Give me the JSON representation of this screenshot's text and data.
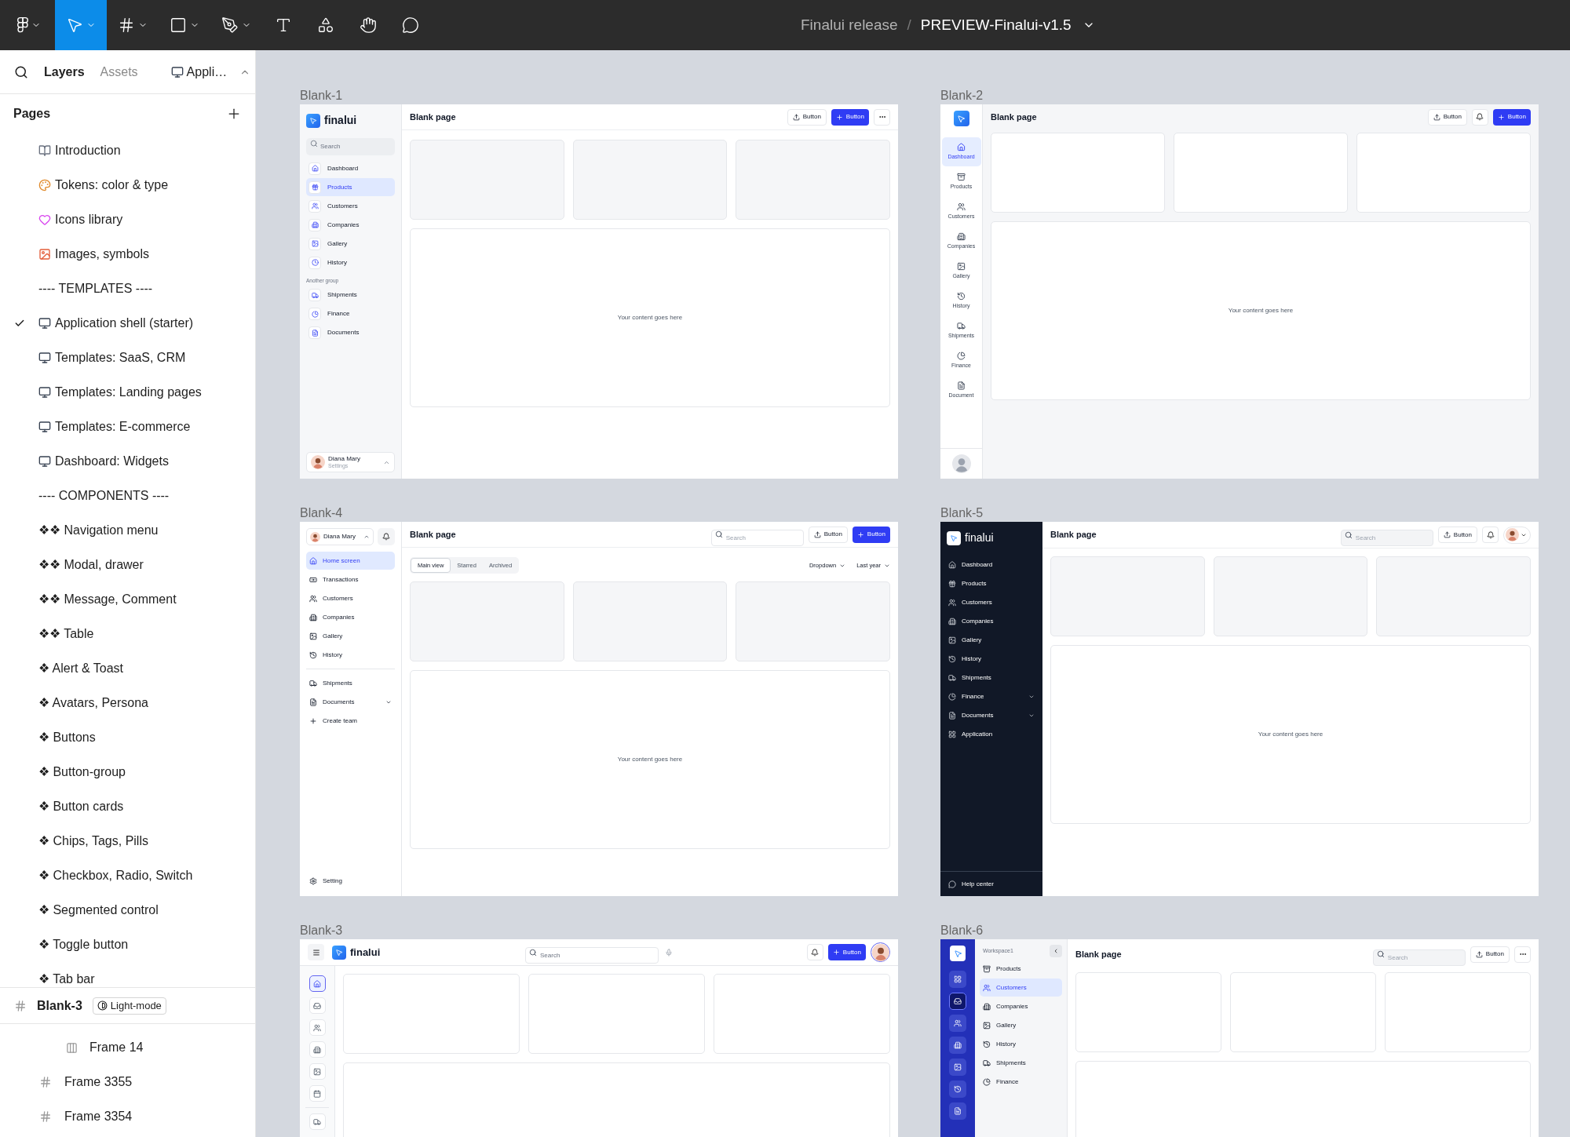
{
  "toolbar": {
    "tools": [
      {
        "selected": false,
        "menu": true
      },
      {
        "selected": true,
        "menu": true
      },
      {
        "selected": false,
        "menu": true
      },
      {
        "selected": false,
        "menu": true
      },
      {
        "selected": false,
        "menu": true
      },
      {
        "selected": false,
        "menu": false
      },
      {
        "selected": false,
        "menu": false
      },
      {
        "selected": false,
        "menu": false
      },
      {
        "selected": false,
        "menu": false
      }
    ],
    "project": "Finalui release",
    "separator": "/",
    "file": "PREVIEW-Finalui-v1.5"
  },
  "left_panel": {
    "tabs": [
      {
        "label": "Layers",
        "selected": true
      },
      {
        "label": "Assets",
        "selected": false
      }
    ],
    "page_picker": "Appli…",
    "pages_title": "Pages",
    "pages": [
      {
        "label": "Introduction",
        "kind": "book",
        "selected": false
      },
      {
        "label": "Tokens: color & type",
        "kind": "palette",
        "selected": false
      },
      {
        "label": "Icons library",
        "kind": "heart",
        "selected": false
      },
      {
        "label": "Images, symbols",
        "kind": "image",
        "selected": false
      },
      {
        "label": "---- TEMPLATES ----",
        "kind": "text",
        "selected": false
      },
      {
        "label": "Application shell (starter)",
        "kind": "monitor",
        "selected": true
      },
      {
        "label": "Templates: SaaS, CRM",
        "kind": "monitor",
        "selected": false
      },
      {
        "label": "Templates: Landing pages",
        "kind": "monitor",
        "selected": false
      },
      {
        "label": "Templates: E-commerce",
        "kind": "monitor",
        "selected": false
      },
      {
        "label": "Dashboard: Widgets",
        "kind": "monitor",
        "selected": false
      },
      {
        "label": "---- COMPONENTS ----",
        "kind": "text",
        "selected": false
      },
      {
        "label": "❖❖ Navigation menu",
        "kind": "text",
        "selected": false
      },
      {
        "label": "❖❖ Modal, drawer",
        "kind": "text",
        "selected": false
      },
      {
        "label": "❖❖ Message, Comment",
        "kind": "text",
        "selected": false
      },
      {
        "label": "❖❖ Table",
        "kind": "text",
        "selected": false
      },
      {
        "label": "❖ Alert & Toast",
        "kind": "text",
        "selected": false
      },
      {
        "label": "❖ Avatars, Persona",
        "kind": "text",
        "selected": false
      },
      {
        "label": "❖ Buttons",
        "kind": "text",
        "selected": false
      },
      {
        "label": "❖ Button-group",
        "kind": "text",
        "selected": false
      },
      {
        "label": "❖ Button cards",
        "kind": "text",
        "selected": false
      },
      {
        "label": "❖ Chips, Tags, Pills",
        "kind": "text",
        "selected": false
      },
      {
        "label": "❖ Checkbox, Radio, Switch",
        "kind": "text",
        "selected": false
      },
      {
        "label": "❖ Segmented control",
        "kind": "text",
        "selected": false
      },
      {
        "label": "❖ Toggle button",
        "kind": "text",
        "selected": false
      },
      {
        "label": "❖ Tab bar",
        "kind": "text",
        "selected": false
      }
    ],
    "layer": {
      "name": "Blank-3",
      "badge": "Light-mode",
      "children": [
        {
          "name": "Frame 14",
          "kind": "autolayout"
        },
        {
          "name": "Frame 3355",
          "kind": "frame"
        },
        {
          "name": "Frame 3354",
          "kind": "frame"
        }
      ]
    }
  },
  "canvas": {
    "frames": [
      {
        "label": "Blank-1",
        "kind": "sidebar",
        "brand": "finalui",
        "search": {
          "placeholder": "Search"
        },
        "nav": [
          {
            "label": "Dashboard",
            "selected": false
          },
          {
            "label": "Products",
            "selected": true
          },
          {
            "label": "Customers",
            "selected": false
          },
          {
            "label": "Companies",
            "selected": false
          },
          {
            "label": "Gallery",
            "selected": false
          },
          {
            "label": "History",
            "selected": false
          }
        ],
        "group_title": "Another group",
        "nav2": [
          {
            "label": "Shipments",
            "selected": false
          },
          {
            "label": "Finance",
            "selected": false
          },
          {
            "label": "Documents",
            "selected": false
          }
        ],
        "user": {
          "name": "Diana Mary",
          "subtitle": "Settings"
        },
        "title": "Blank page",
        "actions": [
          {
            "kind": "outline",
            "label": "Button"
          },
          {
            "kind": "primary",
            "label": "Button"
          },
          {
            "kind": "more"
          }
        ],
        "placeholder_text": "Your content goes here"
      },
      {
        "label": "Blank-2",
        "kind": "rail",
        "nav": [
          {
            "label": "Dashboard",
            "selected": true
          },
          {
            "label": "Products",
            "selected": false
          },
          {
            "label": "Customers",
            "selected": false
          },
          {
            "label": "Companies",
            "selected": false
          },
          {
            "label": "Gallery",
            "selected": false
          },
          {
            "label": "History",
            "selected": false
          },
          {
            "label": "Shipments",
            "selected": false
          },
          {
            "label": "Finance",
            "selected": false
          },
          {
            "label": "Document",
            "selected": false
          }
        ],
        "title": "Blank page",
        "actions": [
          {
            "kind": "outline",
            "label": "Button"
          },
          {
            "kind": "bell"
          },
          {
            "kind": "primary",
            "label": "Button"
          }
        ],
        "placeholder_text": "Your content goes here"
      },
      {
        "label": "Blank-4",
        "kind": "team",
        "user": {
          "name": "Diana Mary"
        },
        "nav": [
          {
            "label": "Home screen",
            "selected": true
          },
          {
            "label": "Transactions",
            "selected": false
          },
          {
            "label": "Customers",
            "selected": false
          },
          {
            "label": "Companies",
            "selected": false
          },
          {
            "label": "Gallery",
            "selected": false
          },
          {
            "label": "History",
            "selected": false
          }
        ],
        "nav2": [
          {
            "label": "Shipments",
            "expandable": false
          },
          {
            "label": "Documents",
            "expandable": true
          },
          {
            "label": "Create team",
            "expandable": false
          }
        ],
        "footer": "Setting",
        "title": "Blank page",
        "actions": [
          {
            "kind": "search",
            "placeholder": "Search",
            "filled": false
          },
          {
            "kind": "outline",
            "label": "Button"
          },
          {
            "kind": "primary",
            "label": "Button"
          }
        ],
        "tabs": [
          {
            "label": "Main view",
            "selected": true
          },
          {
            "label": "Starred",
            "selected": false
          },
          {
            "label": "Archived",
            "selected": false
          }
        ],
        "filters": [
          "Dropdown",
          "Last year"
        ],
        "placeholder_text": "Your content goes here"
      },
      {
        "label": "Blank-5",
        "kind": "dark",
        "brand": "finalui",
        "nav": [
          {
            "label": "Dashboard",
            "expandable": false
          },
          {
            "label": "Products",
            "expandable": false
          },
          {
            "label": "Customers",
            "expandable": false
          },
          {
            "label": "Companies",
            "expandable": false
          },
          {
            "label": "Gallery",
            "expandable": false
          },
          {
            "label": "History",
            "expandable": false
          },
          {
            "label": "Shipments",
            "expandable": false
          },
          {
            "label": "Finance",
            "expandable": true
          },
          {
            "label": "Documents",
            "expandable": true
          },
          {
            "label": "Application",
            "expandable": false
          }
        ],
        "footer": "Help center",
        "title": "Blank page",
        "actions": [
          {
            "kind": "search",
            "placeholder": "Search",
            "filled": true
          },
          {
            "kind": "outline",
            "label": "Button"
          },
          {
            "kind": "bell"
          },
          {
            "kind": "avatar"
          }
        ],
        "placeholder_text": "Your content goes here"
      },
      {
        "label": "Blank-3",
        "kind": "topnav",
        "brand": "finalui",
        "search": {
          "placeholder": "Search"
        },
        "rail": [
          [
            {
              "selected": true
            },
            {
              "selected": false
            },
            {
              "selected": false
            },
            {
              "selected": false
            },
            {
              "selected": false
            },
            {
              "selected": false
            }
          ],
          [
            {
              "selected": false
            }
          ]
        ],
        "actions": [
          {
            "kind": "bell"
          },
          {
            "kind": "primary",
            "label": "Button"
          },
          {
            "kind": "avatar_ring"
          }
        ]
      },
      {
        "label": "Blank-6",
        "kind": "workspace",
        "rail": [
          {
            "selected": false
          },
          {
            "selected": true
          },
          {
            "selected": false
          },
          {
            "selected": false
          },
          {
            "selected": false
          },
          {
            "selected": false
          },
          {
            "selected": false
          }
        ],
        "workspace": "Workspace1",
        "nav": [
          {
            "label": "Products",
            "selected": false
          },
          {
            "label": "Customers",
            "selected": true
          },
          {
            "label": "Companies",
            "selected": false
          },
          {
            "label": "Gallery",
            "selected": false
          },
          {
            "label": "History",
            "selected": false
          },
          {
            "label": "Shipments",
            "selected": false
          },
          {
            "label": "Finance",
            "selected": false
          }
        ],
        "title": "Blank page",
        "actions": [
          {
            "kind": "search",
            "placeholder": "Search",
            "filled": true
          },
          {
            "kind": "outline",
            "label": "Button"
          },
          {
            "kind": "more"
          }
        ]
      }
    ]
  }
}
